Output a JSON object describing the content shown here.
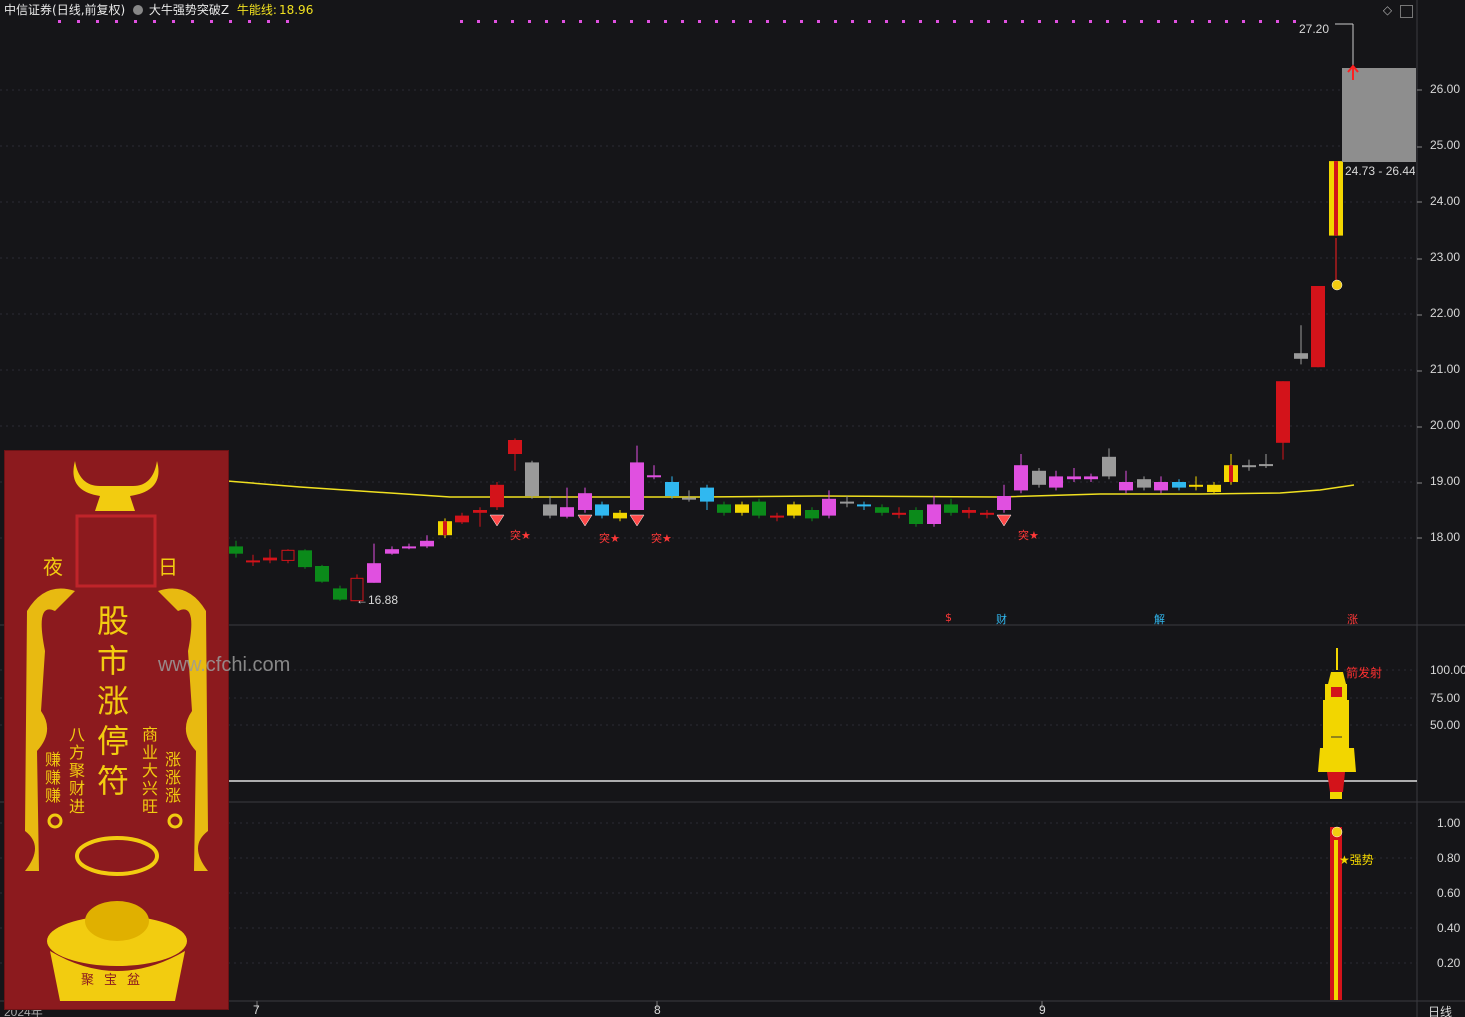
{
  "header": {
    "security": "中信证券",
    "period": "(日线,前复权)",
    "indicator_name": "大牛强势突破Z",
    "line_label": "牛能线:",
    "line_value": "18.96"
  },
  "price_axis": [
    "26.00",
    "25.00",
    "24.00",
    "23.00",
    "22.00",
    "21.00",
    "20.00",
    "19.00",
    "18.00"
  ],
  "macd_axis": [
    "100.00",
    "75.00",
    "50.00"
  ],
  "strength_axis": [
    "1.00",
    "0.80",
    "0.60",
    "0.40",
    "0.20"
  ],
  "x_axis": {
    "year": "2024年",
    "labels": [
      "7",
      "8",
      "9"
    ],
    "period": "日线"
  },
  "annotations": {
    "high_label": "27.20",
    "low_label": "←16.88",
    "range_label": "24.73 - 26.44",
    "breakout": "突★",
    "rocket": "箭发射",
    "strong": "★强势",
    "events": [
      "$",
      "财",
      "解",
      "涨"
    ]
  },
  "watermark": "www.cfchi.com",
  "poster": {
    "title": "股市涨停符",
    "left_top": "夜",
    "right_top": "日",
    "left_col1": "八方聚财进",
    "left_col2": "赚赚赚",
    "right_col1": "商业大兴旺",
    "right_col2": "涨涨涨",
    "bowl": "聚宝盆"
  },
  "colors": {
    "up": "#d3131a",
    "down": "#0b8a1a",
    "ma": "#f0e020",
    "magenta": "#e050e0",
    "cyan": "#30b8f0",
    "gray": "#9a9a9a",
    "yellow": "#f2d600"
  }
}
